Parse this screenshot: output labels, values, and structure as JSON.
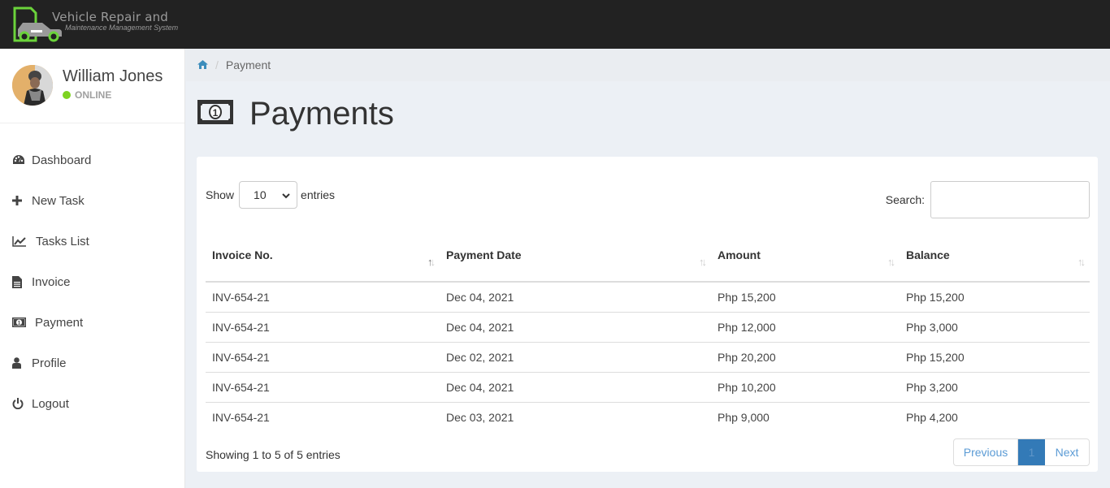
{
  "app": {
    "logo_title": "Vehicle Repair and",
    "logo_subtitle": "Maintenance Management System",
    "brand_color": "#6bd33b"
  },
  "user": {
    "name": "William Jones",
    "status": "ONLINE",
    "status_color": "#7ed321"
  },
  "sidebar": {
    "items": [
      {
        "label": "Dashboard",
        "icon": "dashboard-icon"
      },
      {
        "label": "New Task",
        "icon": "plus-icon"
      },
      {
        "label": "Tasks List",
        "icon": "line-chart-icon"
      },
      {
        "label": "Invoice",
        "icon": "file-text-icon"
      },
      {
        "label": "Payment",
        "icon": "money-icon"
      },
      {
        "label": "Profile",
        "icon": "user-icon"
      },
      {
        "label": "Logout",
        "icon": "power-icon"
      }
    ]
  },
  "breadcrumb": {
    "home_icon": "home-icon",
    "separator": "/",
    "current": "Payment"
  },
  "page": {
    "title": "Payments",
    "icon": "money-icon"
  },
  "table_controls": {
    "show_label": "Show",
    "entries_label": "entries",
    "page_length": "10",
    "search_label": "Search:",
    "search_value": ""
  },
  "table": {
    "columns": [
      "Invoice No.",
      "Payment Date",
      "Amount",
      "Balance"
    ],
    "rows": [
      [
        "INV-654-21",
        "Dec 04, 2021",
        "Php 15,200",
        "Php 15,200"
      ],
      [
        "INV-654-21",
        "Dec 04, 2021",
        "Php 12,000",
        "Php 3,000"
      ],
      [
        "INV-654-21",
        "Dec 02, 2021",
        "Php 20,200",
        "Php 15,200"
      ],
      [
        "INV-654-21",
        "Dec 04, 2021",
        "Php 10,200",
        "Php 3,200"
      ],
      [
        "INV-654-21",
        "Dec 03, 2021",
        "Php 9,000",
        "Php 4,200"
      ]
    ]
  },
  "footer": {
    "info": "Showing 1 to 5 of 5 entries",
    "previous": "Previous",
    "current_page": "1",
    "next": "Next",
    "active_color": "#337ab7"
  }
}
